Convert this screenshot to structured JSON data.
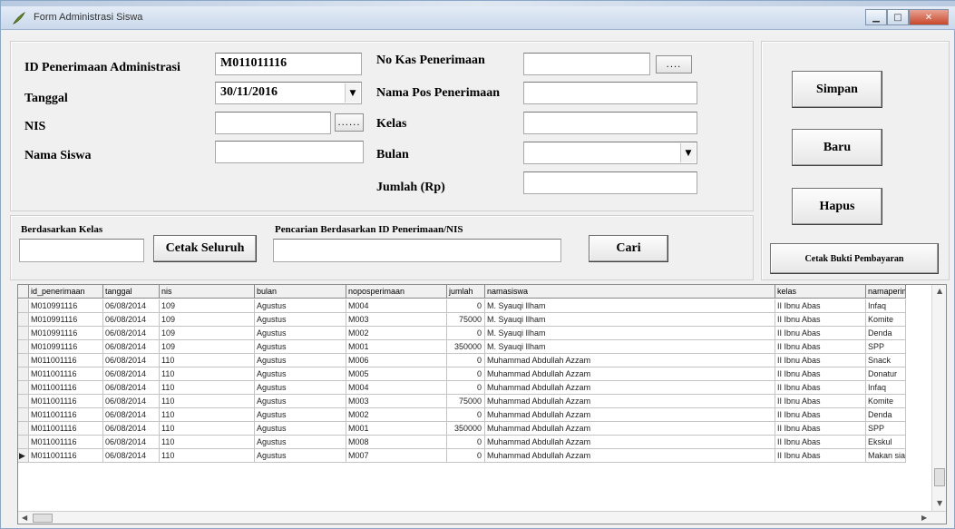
{
  "window": {
    "title": "Form Administrasi Siswa",
    "accent": "#c8472a"
  },
  "form": {
    "id_label": "ID Penerimaan Administrasi",
    "id_value": "M011011116",
    "tanggal_label": "Tanggal",
    "tanggal_value": "30/11/2016",
    "nis_label": "NIS",
    "nis_value": "",
    "nama_siswa_label": "Nama Siswa",
    "nama_siswa_value": "",
    "no_kas_label": "No Kas Penerimaan",
    "no_kas_value": "",
    "nama_pos_label": "Nama Pos Penerimaan",
    "nama_pos_value": "",
    "kelas_label": "Kelas",
    "kelas_value": "",
    "bulan_label": "Bulan",
    "bulan_value": "",
    "jumlah_label": "Jumlah  (Rp)",
    "jumlah_value": "",
    "lookup_label": "......",
    "lookup_label_alt": "....",
    "dropdown_arrow": "▼"
  },
  "buttons": {
    "simpan": "Simpan",
    "baru": "Baru",
    "hapus": "Hapus",
    "cetak_bukti": "Cetak Bukti Pembayaran",
    "cetak_seluruh": "Cetak Seluruh",
    "cari": "Cari"
  },
  "search": {
    "kelas_label": "Berdasarkan Kelas",
    "kelas_value": "",
    "id_label": "Pencarian Berdasarkan ID Penerimaan/NIS",
    "id_value": ""
  },
  "grid": {
    "columns": [
      "id_penerimaan",
      "tanggal",
      "nis",
      "bulan",
      "noposperimaan",
      "jumlah",
      "namasiswa",
      "kelas",
      "namaperim"
    ],
    "current_row_marker": "▶",
    "rows": [
      [
        "M010991116",
        "06/08/2014",
        "109",
        "Agustus",
        "M004",
        "0",
        "M. Syauqi Ilham",
        "II Ibnu Abas",
        "Infaq"
      ],
      [
        "M010991116",
        "06/08/2014",
        "109",
        "Agustus",
        "M003",
        "75000",
        "M. Syauqi Ilham",
        "II Ibnu Abas",
        "Komite"
      ],
      [
        "M010991116",
        "06/08/2014",
        "109",
        "Agustus",
        "M002",
        "0",
        "M. Syauqi Ilham",
        "II Ibnu Abas",
        "Denda"
      ],
      [
        "M010991116",
        "06/08/2014",
        "109",
        "Agustus",
        "M001",
        "350000",
        "M. Syauqi Ilham",
        "II Ibnu Abas",
        "SPP"
      ],
      [
        "M011001116",
        "06/08/2014",
        "110",
        "Agustus",
        "M006",
        "0",
        "Muhammad Abdullah Azzam",
        "II Ibnu Abas",
        "Snack"
      ],
      [
        "M011001116",
        "06/08/2014",
        "110",
        "Agustus",
        "M005",
        "0",
        "Muhammad Abdullah Azzam",
        "II Ibnu Abas",
        "Donatur"
      ],
      [
        "M011001116",
        "06/08/2014",
        "110",
        "Agustus",
        "M004",
        "0",
        "Muhammad Abdullah Azzam",
        "II Ibnu Abas",
        "Infaq"
      ],
      [
        "M011001116",
        "06/08/2014",
        "110",
        "Agustus",
        "M003",
        "75000",
        "Muhammad Abdullah Azzam",
        "II Ibnu Abas",
        "Komite"
      ],
      [
        "M011001116",
        "06/08/2014",
        "110",
        "Agustus",
        "M002",
        "0",
        "Muhammad Abdullah Azzam",
        "II Ibnu Abas",
        "Denda"
      ],
      [
        "M011001116",
        "06/08/2014",
        "110",
        "Agustus",
        "M001",
        "350000",
        "Muhammad Abdullah Azzam",
        "II Ibnu Abas",
        "SPP"
      ],
      [
        "M011001116",
        "06/08/2014",
        "110",
        "Agustus",
        "M008",
        "0",
        "Muhammad Abdullah Azzam",
        "II Ibnu Abas",
        "Ekskul"
      ],
      [
        "M011001116",
        "06/08/2014",
        "110",
        "Agustus",
        "M007",
        "0",
        "Muhammad Abdullah Azzam",
        "II Ibnu Abas",
        "Makan siang"
      ]
    ]
  }
}
